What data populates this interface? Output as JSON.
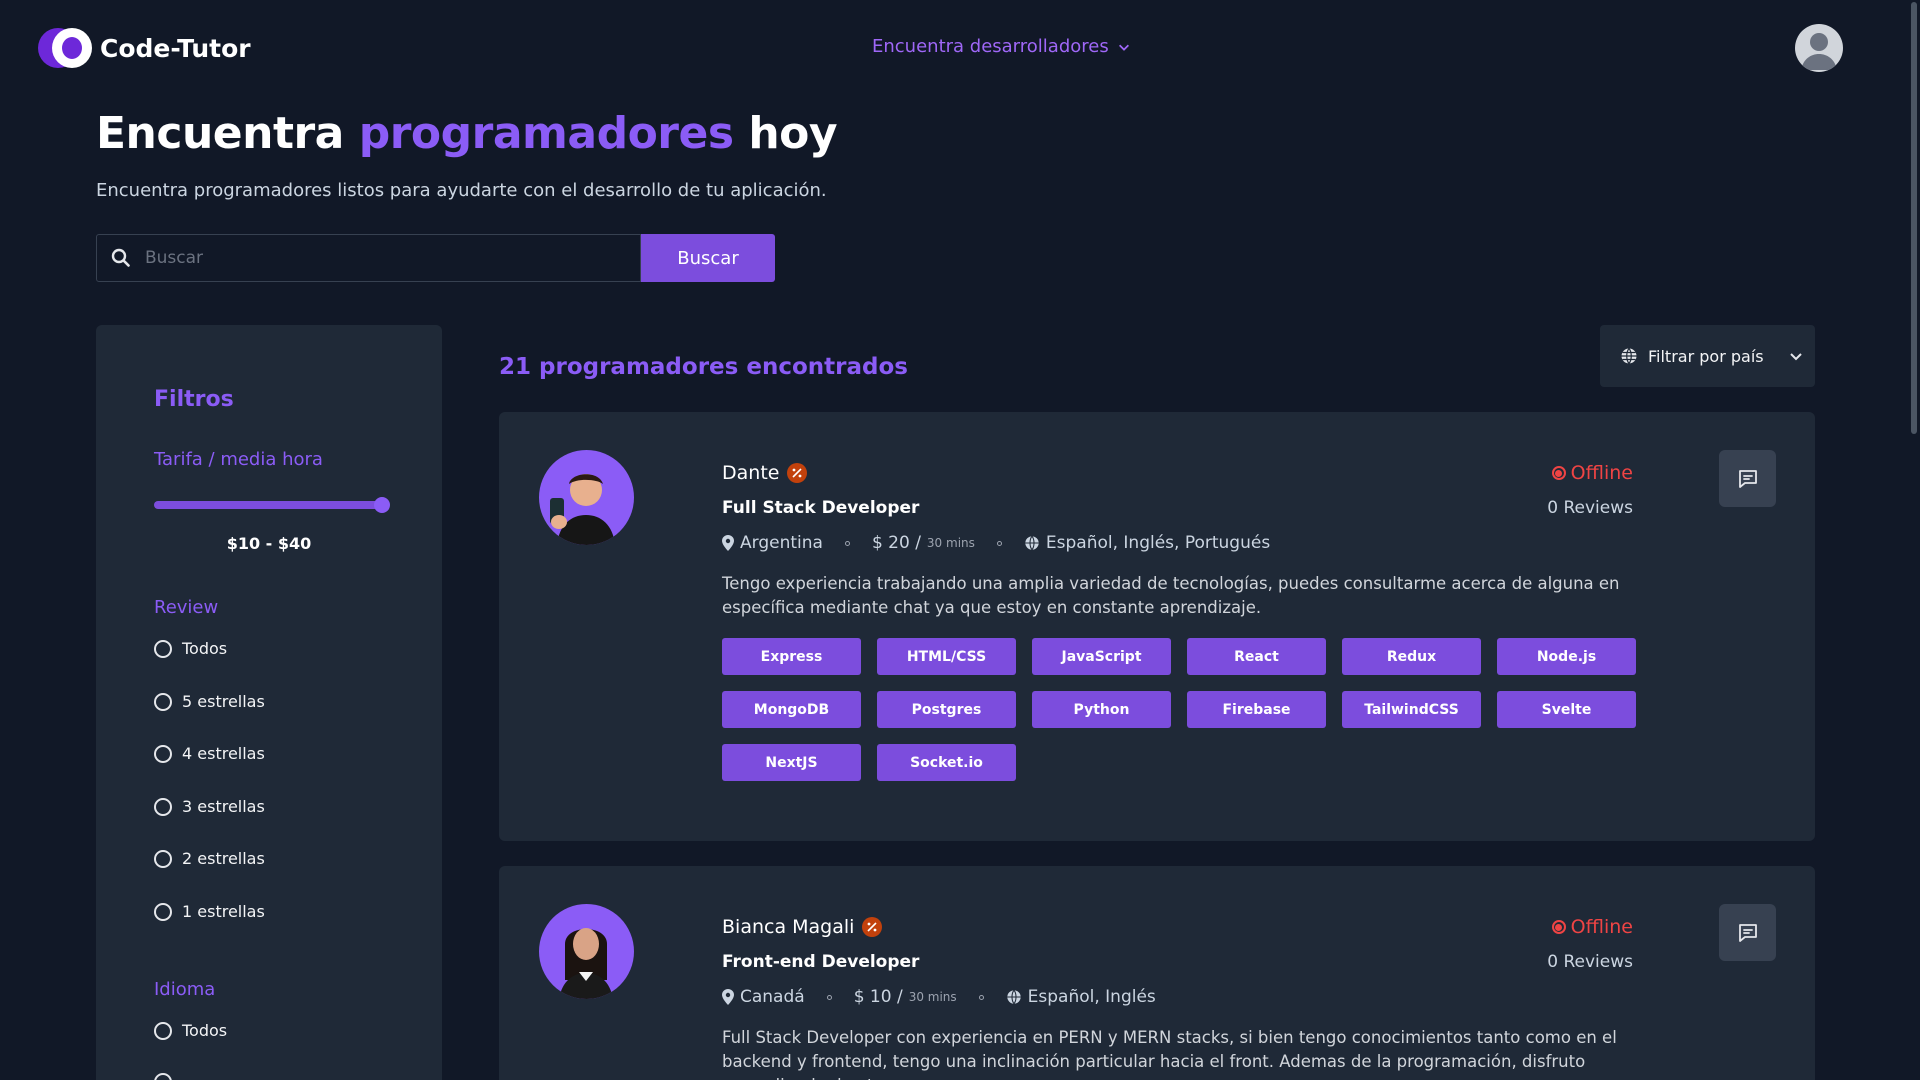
{
  "header": {
    "brand": "Code-Tutor",
    "nav_dropdown": "Encuentra desarrolladores"
  },
  "hero": {
    "title_start": "Encuentra",
    "title_accent": "programadores",
    "title_end": "hoy",
    "subtitle": "Encuentra programadores listos para ayudarte con el desarrollo de tu aplicación.",
    "search_placeholder": "Buscar",
    "search_button": "Buscar"
  },
  "filters": {
    "title": "Filtros",
    "rate_label": "Tarifa / media hora",
    "rate_range": "$10 - $40",
    "review_label": "Review",
    "review_options": [
      "Todos",
      "5 estrellas",
      "4 estrellas",
      "3 estrellas",
      "2 estrellas",
      "1 estrellas"
    ],
    "language_label": "Idioma",
    "language_options": [
      "Todos"
    ]
  },
  "results": {
    "count_text": "21 programadores encontrados",
    "country_filter": "Filtrar por país"
  },
  "developers": [
    {
      "name": "Dante",
      "role": "Full Stack Developer",
      "country": "Argentina",
      "price": "$ 20 /",
      "price_unit": "30 mins",
      "languages": "Español, Inglés, Portugués",
      "status": "Offline",
      "reviews": "0 Reviews",
      "description": "Tengo experiencia trabajando una amplia variedad de tecnologías, puedes consultarme acerca de alguna en específica mediante chat ya que estoy en constante aprendizaje.",
      "skills": [
        "Express",
        "HTML/CSS",
        "JavaScript",
        "React",
        "Redux",
        "Node.js",
        "MongoDB",
        "Postgres",
        "Python",
        "Firebase",
        "TailwindCSS",
        "Svelte",
        "NextJS",
        "Socket.io"
      ]
    },
    {
      "name": "Bianca Magali",
      "role": "Front-end Developer",
      "country": "Canadá",
      "price": "$ 10 /",
      "price_unit": "30 mins",
      "languages": "Español, Inglés",
      "status": "Offline",
      "reviews": "0 Reviews",
      "description": "Full Stack Developer con experiencia en PERN y MERN stacks, si bien tengo conocimientos tanto como en el backend y frontend, tengo una inclinación particular hacia el front. Ademas de la programación, disfruto aprendiendo de otras"
    }
  ],
  "colors": {
    "background": "#111827",
    "panel": "#1f2937",
    "accent": "#8b5cf6",
    "button": "#7c4ddd",
    "offline": "#ef4444"
  }
}
